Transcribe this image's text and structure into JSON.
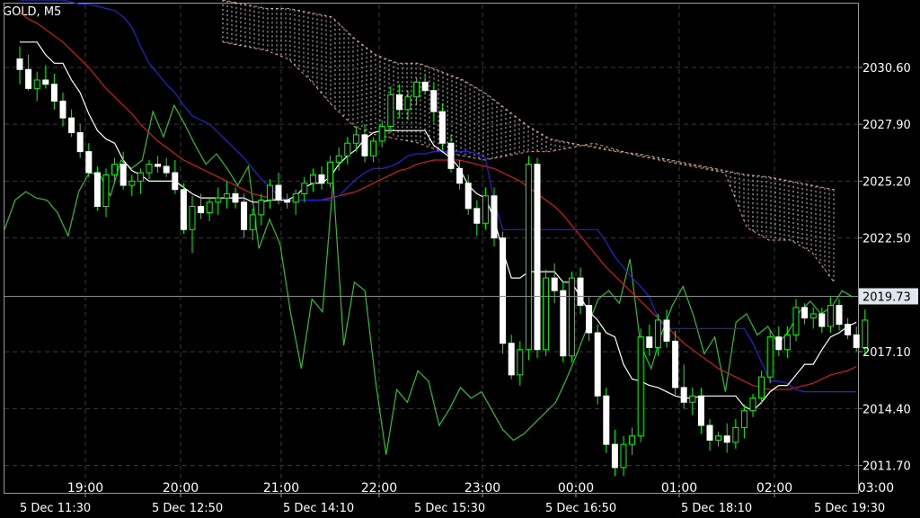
{
  "symbol_label": "GOLD, M5",
  "chart_data": {
    "type": "candlestick",
    "symbol": "GOLD",
    "timeframe": "M5",
    "current_price": "2019.73",
    "y_ticks": [
      "2030.60",
      "2027.90",
      "2025.20",
      "2022.50",
      "2017.10",
      "2014.40",
      "2011.70"
    ],
    "time_ticks": [
      "19:00",
      "20:00",
      "21:00",
      "22:00",
      "23:00",
      "00:00",
      "01:00",
      "02:00",
      "03:00"
    ],
    "date_ticks": [
      "5 Dec 11:30",
      "5 Dec 12:50",
      "5 Dec 14:10",
      "5 Dec 15:30",
      "5 Dec 16:50",
      "5 Dec 18:10",
      "5 Dec 19:30"
    ],
    "ylim": [
      2010.4,
      2033.8
    ],
    "grid": true,
    "colors": {
      "background": "#000000",
      "grid": "#3a3a3a",
      "candle": "#ffffff",
      "wick": "#00ff00",
      "price_line": "#8a8a8a",
      "price_label_bg": "#dfe6ee"
    },
    "candles": [
      [
        2031.0,
        2031.6,
        2029.8,
        2030.5
      ],
      [
        2030.5,
        2031.2,
        2029.5,
        2029.6
      ],
      [
        2029.6,
        2030.4,
        2029.0,
        2030.0
      ],
      [
        2030.0,
        2030.7,
        2029.6,
        2029.8
      ],
      [
        2029.8,
        2030.3,
        2028.6,
        2029.0
      ],
      [
        2029.0,
        2029.4,
        2027.8,
        2028.2
      ],
      [
        2028.2,
        2028.6,
        2027.3,
        2027.5
      ],
      [
        2027.5,
        2027.9,
        2026.3,
        2026.6
      ],
      [
        2026.6,
        2027.0,
        2025.4,
        2025.6
      ],
      [
        2025.6,
        2025.9,
        2023.8,
        2024.0
      ],
      [
        2024.0,
        2025.8,
        2023.5,
        2025.5
      ],
      [
        2025.5,
        2026.3,
        2025.1,
        2026.0
      ],
      [
        2026.0,
        2026.6,
        2024.8,
        2025.0
      ],
      [
        2025.0,
        2025.5,
        2024.5,
        2025.2
      ],
      [
        2025.2,
        2025.8,
        2024.6,
        2025.6
      ],
      [
        2025.6,
        2026.2,
        2025.3,
        2026.0
      ],
      [
        2026.0,
        2026.4,
        2025.6,
        2025.9
      ],
      [
        2025.9,
        2026.3,
        2025.4,
        2025.6
      ],
      [
        2025.6,
        2026.2,
        2024.6,
        2024.8
      ],
      [
        2024.8,
        2025.1,
        2022.7,
        2022.9
      ],
      [
        2022.9,
        2024.5,
        2021.8,
        2024.0
      ],
      [
        2024.0,
        2024.6,
        2023.4,
        2023.7
      ],
      [
        2023.7,
        2024.4,
        2023.3,
        2024.2
      ],
      [
        2024.2,
        2024.9,
        2023.6,
        2024.4
      ],
      [
        2024.4,
        2025.2,
        2023.9,
        2024.6
      ],
      [
        2024.6,
        2024.9,
        2023.9,
        2024.2
      ],
      [
        2024.2,
        2024.6,
        2022.5,
        2022.9
      ],
      [
        2022.9,
        2023.9,
        2022.4,
        2023.6
      ],
      [
        2023.6,
        2024.6,
        2023.1,
        2024.3
      ],
      [
        2024.3,
        2025.3,
        2023.9,
        2025.0
      ],
      [
        2025.0,
        2025.6,
        2024.1,
        2024.3
      ],
      [
        2024.3,
        2024.6,
        2023.9,
        2024.2
      ],
      [
        2024.2,
        2024.8,
        2023.6,
        2024.6
      ],
      [
        2024.6,
        2025.4,
        2024.2,
        2025.1
      ],
      [
        2025.1,
        2025.8,
        2024.7,
        2025.5
      ],
      [
        2025.5,
        2025.9,
        2024.8,
        2025.1
      ],
      [
        2025.1,
        2026.4,
        2024.9,
        2026.1
      ],
      [
        2026.1,
        2026.8,
        2025.7,
        2026.4
      ],
      [
        2026.4,
        2027.3,
        2026.0,
        2027.0
      ],
      [
        2027.0,
        2027.8,
        2026.6,
        2027.4
      ],
      [
        2027.4,
        2027.9,
        2026.1,
        2026.4
      ],
      [
        2026.4,
        2027.3,
        2026.1,
        2027.1
      ],
      [
        2027.1,
        2028.1,
        2026.8,
        2027.8
      ],
      [
        2027.8,
        2029.7,
        2027.5,
        2029.3
      ],
      [
        2029.3,
        2029.8,
        2028.2,
        2028.6
      ],
      [
        2028.6,
        2029.5,
        2028.1,
        2029.2
      ],
      [
        2029.2,
        2030.1,
        2028.8,
        2029.9
      ],
      [
        2029.9,
        2030.3,
        2029.3,
        2029.5
      ],
      [
        2029.5,
        2029.9,
        2028.0,
        2028.5
      ],
      [
        2028.5,
        2028.9,
        2026.7,
        2027.0
      ],
      [
        2027.0,
        2027.4,
        2025.6,
        2025.8
      ],
      [
        2025.8,
        2026.2,
        2024.8,
        2025.1
      ],
      [
        2025.1,
        2025.5,
        2023.6,
        2023.9
      ],
      [
        2023.9,
        2024.3,
        2022.6,
        2023.2
      ],
      [
        2023.2,
        2024.9,
        2022.9,
        2024.5
      ],
      [
        2024.5,
        2024.9,
        2022.1,
        2022.5
      ],
      [
        2022.5,
        2022.8,
        2017.0,
        2017.5
      ],
      [
        2017.5,
        2017.9,
        2015.8,
        2016.0
      ],
      [
        2016.0,
        2017.6,
        2015.5,
        2017.2
      ],
      [
        2017.2,
        2026.4,
        2016.7,
        2026.0
      ],
      [
        2026.0,
        2026.3,
        2016.8,
        2017.2
      ],
      [
        2017.2,
        2021.0,
        2016.9,
        2020.6
      ],
      [
        2020.6,
        2021.3,
        2019.4,
        2020.0
      ],
      [
        2020.0,
        2020.4,
        2016.6,
        2016.9
      ],
      [
        2016.9,
        2020.9,
        2016.6,
        2020.6
      ],
      [
        2020.6,
        2021.1,
        2018.9,
        2019.3
      ],
      [
        2019.3,
        2019.7,
        2017.6,
        2018.0
      ],
      [
        2018.0,
        2018.4,
        2014.6,
        2015.0
      ],
      [
        2015.0,
        2015.4,
        2012.3,
        2012.7
      ],
      [
        2012.7,
        2013.4,
        2011.2,
        2011.6
      ],
      [
        2011.6,
        2013.1,
        2011.2,
        2012.7
      ],
      [
        2012.7,
        2013.5,
        2012.2,
        2013.1
      ],
      [
        2013.1,
        2018.2,
        2012.8,
        2017.8
      ],
      [
        2017.8,
        2018.4,
        2016.9,
        2017.3
      ],
      [
        2017.3,
        2018.9,
        2016.9,
        2018.6
      ],
      [
        2018.6,
        2019.1,
        2017.3,
        2017.6
      ],
      [
        2017.6,
        2018.1,
        2015.0,
        2015.4
      ],
      [
        2015.4,
        2016.5,
        2014.4,
        2014.7
      ],
      [
        2014.7,
        2015.4,
        2014.1,
        2015.0
      ],
      [
        2015.0,
        2015.4,
        2013.2,
        2013.6
      ],
      [
        2013.6,
        2013.9,
        2012.4,
        2012.9
      ],
      [
        2012.9,
        2013.3,
        2012.6,
        2013.1
      ],
      [
        2013.1,
        2013.7,
        2012.3,
        2012.8
      ],
      [
        2012.8,
        2013.9,
        2012.5,
        2013.5
      ],
      [
        2013.5,
        2014.6,
        2013.0,
        2014.3
      ],
      [
        2014.3,
        2015.1,
        2014.0,
        2014.9
      ],
      [
        2014.9,
        2016.2,
        2014.6,
        2015.9
      ],
      [
        2015.9,
        2018.1,
        2015.6,
        2017.8
      ],
      [
        2017.8,
        2018.3,
        2016.9,
        2017.2
      ],
      [
        2017.2,
        2018.3,
        2016.8,
        2017.9
      ],
      [
        2017.9,
        2019.6,
        2017.6,
        2019.2
      ],
      [
        2019.2,
        2019.4,
        2018.4,
        2018.7
      ],
      [
        2018.7,
        2019.2,
        2018.2,
        2018.9
      ],
      [
        2018.9,
        2019.2,
        2018.0,
        2018.3
      ],
      [
        2018.3,
        2019.7,
        2018.0,
        2019.3
      ],
      [
        2019.3,
        2019.6,
        2018.1,
        2018.4
      ],
      [
        2018.4,
        2018.7,
        2017.7,
        2017.9
      ],
      [
        2017.9,
        2018.3,
        2017.1,
        2017.3
      ],
      [
        2017.3,
        2019.1,
        2016.9,
        2018.6
      ]
    ],
    "tenkan_white": [
      2031.8,
      2031.8,
      2031.8,
      2031.2,
      2030.8,
      2030.8,
      2030.0,
      2029.4,
      2028.4,
      2027.6,
      2027.2,
      2027.0,
      2026.2,
      2025.7,
      2025.5,
      2025.2,
      2025.2,
      2025.2,
      2025.2,
      2024.9,
      2024.6,
      2024.4,
      2024.4,
      2024.4,
      2024.4,
      2024.4,
      2024.4,
      2024.2,
      2024.2,
      2024.3,
      2024.3,
      2024.3,
      2024.5,
      2024.9,
      2025.1,
      2025.1,
      2025.4,
      2026.0,
      2026.4,
      2026.7,
      2027.2,
      2027.5,
      2027.6,
      2027.6,
      2027.6,
      2027.6,
      2027.6,
      2027.6,
      2026.9,
      2026.6,
      2026.3,
      2025.8,
      2025.0,
      2024.6,
      2024.4,
      2023.4,
      2021.9,
      2020.6,
      2020.6,
      2020.9,
      2020.9,
      2020.9,
      2020.9,
      2020.4,
      2020.4,
      2019.7,
      2019.0,
      2018.6,
      2018.0,
      2017.8,
      2016.5,
      2015.8,
      2015.7,
      2015.5,
      2015.4,
      2015.2,
      2015.0,
      2014.9,
      2014.9,
      2015.0,
      2015.0,
      2015.0,
      2015.0,
      2015.0,
      2014.5,
      2014.3,
      2014.7,
      2015.2,
      2015.5,
      2015.5,
      2016.0,
      2016.5,
      2016.5,
      2017.2,
      2017.8,
      2018.0,
      2018.3,
      2018.5
    ],
    "kijun_blue": [
      2033.8,
      2033.8,
      2033.8,
      2033.8,
      2033.8,
      2033.8,
      2033.7,
      2033.6,
      2033.6,
      2033.5,
      2033.4,
      2033.3,
      2033.0,
      2032.5,
      2031.6,
      2030.8,
      2030.3,
      2029.8,
      2029.4,
      2028.8,
      2028.3,
      2028.1,
      2027.9,
      2027.5,
      2027.1,
      2026.7,
      2026.3,
      2025.8,
      2025.3,
      2024.9,
      2024.5,
      2024.3,
      2024.3,
      2024.3,
      2024.3,
      2024.3,
      2024.3,
      2024.5,
      2024.9,
      2025.3,
      2025.6,
      2025.8,
      2025.8,
      2025.9,
      2026.1,
      2026.4,
      2026.5,
      2026.5,
      2026.6,
      2026.6,
      2026.6,
      2026.6,
      2026.6,
      2026.5,
      2026.3,
      2024.2,
      2022.9,
      2022.9,
      2022.9,
      2022.9,
      2022.9,
      2022.9,
      2022.9,
      2022.9,
      2022.9,
      2022.9,
      2022.9,
      2022.9,
      2022.3,
      2021.6,
      2021.1,
      2020.6,
      2020.2,
      2019.7,
      2018.7,
      2018.2,
      2018.2,
      2018.2,
      2018.2,
      2018.2,
      2018.2,
      2018.2,
      2018.2,
      2018.2,
      2018.2,
      2017.5,
      2016.6,
      2015.7,
      2015.7,
      2015.6,
      2015.3,
      2015.2,
      2015.2,
      2015.2,
      2015.2,
      2015.2,
      2015.2,
      2015.2
    ],
    "ma_red": [
      2033.2,
      2032.9,
      2032.7,
      2032.4,
      2032.1,
      2031.8,
      2031.4,
      2031.0,
      2030.6,
      2030.1,
      2029.6,
      2029.2,
      2028.8,
      2028.4,
      2027.9,
      2027.5,
      2027.1,
      2026.8,
      2026.5,
      2026.2,
      2026.0,
      2025.8,
      2025.6,
      2025.4,
      2025.2,
      2025.0,
      2024.8,
      2024.6,
      2024.5,
      2024.4,
      2024.3,
      2024.3,
      2024.3,
      2024.3,
      2024.3,
      2024.3,
      2024.4,
      2024.5,
      2024.6,
      2024.7,
      2024.9,
      2025.1,
      2025.3,
      2025.5,
      2025.7,
      2025.8,
      2026.0,
      2026.1,
      2026.2,
      2026.2,
      2026.2,
      2026.2,
      2026.1,
      2026.0,
      2025.9,
      2025.8,
      2025.6,
      2025.4,
      2025.2,
      2024.9,
      2024.6,
      2024.3,
      2024.0,
      2023.6,
      2023.1,
      2022.6,
      2022.1,
      2021.6,
      2021.1,
      2020.7,
      2020.3,
      2019.9,
      2019.5,
      2019.1,
      2018.7,
      2018.3,
      2017.9,
      2017.5,
      2017.2,
      2016.9,
      2016.6,
      2016.3,
      2016.1,
      2015.9,
      2015.7,
      2015.5,
      2015.4,
      2015.3,
      2015.3,
      2015.3,
      2015.4,
      2015.5,
      2015.6,
      2015.8,
      2016.0,
      2016.1,
      2016.2,
      2016.4
    ],
    "chikou_green": [
      2022.9,
      2024.3,
      2024.7,
      2024.4,
      2024.3,
      2023.7,
      2022.6,
      2024.7,
      2025.6,
      2025.5,
      2024.5,
      2026.2,
      2025.8,
      2026.2,
      2028.5,
      2027.3,
      2028.8,
      2027.9,
      2026.9,
      2026.0,
      2026.5,
      2025.8,
      2025.0,
      2025.9,
      2022.0,
      2023.4,
      2022.2,
      2018.9,
      2016.3,
      2019.6,
      2019.0,
      2025.2,
      2017.4,
      2020.4,
      2020.0,
      2015.7,
      2012.2,
      2015.3,
      2014.7,
      2016.2,
      2015.7,
      2013.6,
      2014.4,
      2015.4,
      2014.9,
      2015.2,
      2014.3,
      2013.4,
      2012.9,
      2013.2,
      2013.7,
      2014.2,
      2014.7,
      2015.8,
      2017.0,
      2018.3,
      2019.6,
      2020.0,
      2019.4,
      2021.5,
      2017.4,
      2016.3,
      2018.0,
      2019.3,
      2020.2,
      2018.8,
      2017.0,
      2017.8,
      2015.2,
      2018.5,
      2018.9,
      2017.9,
      2018.3,
      2017.5,
      2018.1,
      2019.0,
      2019.5,
      2018.9,
      2019.2,
      2020.0,
      2019.7
    ]
  }
}
